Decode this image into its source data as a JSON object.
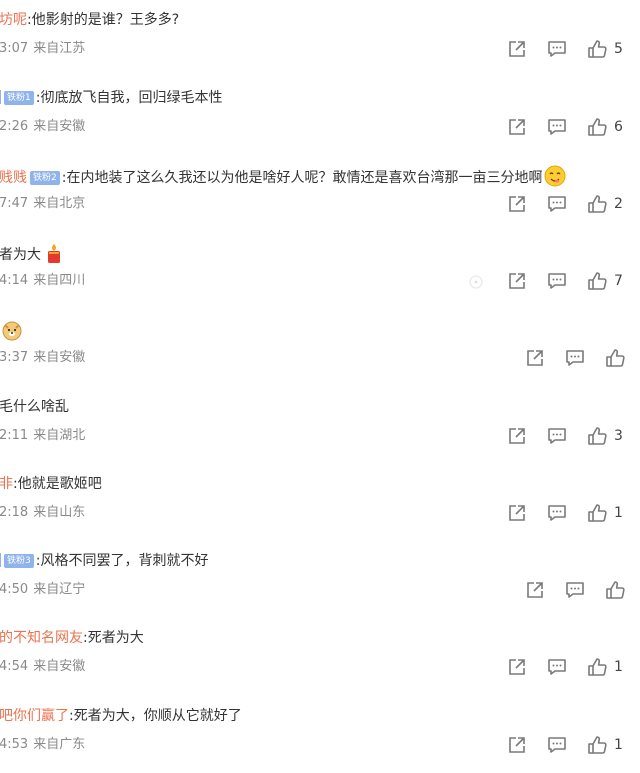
{
  "comments": [
    {
      "name": "坊呢",
      "badge": "",
      "text": ":他影射的是谁？王多多?",
      "time": "3:07",
      "location": "来自江苏",
      "likes": "5",
      "emoji": ""
    },
    {
      "name": "",
      "badge": "铁粉1",
      "text": ":彻底放飞自我，回归绿毛本性",
      "time": "2:26",
      "location": "来自安徽",
      "likes": "6",
      "emoji": ""
    },
    {
      "name": "贱贱",
      "badge": "铁粉2",
      "text": ":在内地装了这么久我还以为他是啥好人呢？敢情还是喜欢台湾那一亩三分地啊",
      "time": "7:47",
      "location": "来自北京",
      "likes": "2",
      "emoji": "yum-emoji"
    },
    {
      "name": "",
      "badge": "",
      "text": "者为大",
      "time": "4:14",
      "location": "来自四川",
      "likes": "7",
      "emoji": "candle-emoji"
    },
    {
      "name": "",
      "badge": "",
      "text": "",
      "time": "3:37",
      "location": "来自安徽",
      "likes": "",
      "emoji": "doge-emoji"
    },
    {
      "name": "",
      "badge": "",
      "text": "毛什么啥乱",
      "time": "2:11",
      "location": "来自湖北",
      "likes": "3",
      "emoji": ""
    },
    {
      "name": "非",
      "badge": "",
      "text": ":他就是歌姬吧",
      "time": "2:18",
      "location": "来自山东",
      "likes": "1",
      "emoji": ""
    },
    {
      "name": "",
      "badge": "铁粉3",
      "text": ":风格不同罢了，背刺就不好",
      "time": "4:50",
      "location": "来自辽宁",
      "likes": "",
      "emoji": ""
    },
    {
      "name": "的不知名网友",
      "badge": "",
      "text": ":死者为大",
      "time": "4:54",
      "location": "来自安徽",
      "likes": "1",
      "emoji": ""
    },
    {
      "name": "吧你们赢了",
      "badge": "",
      "text": ":死者为大，你顺从它就好了",
      "time": "4:53",
      "location": "来自广东",
      "likes": "1",
      "emoji": ""
    }
  ],
  "icons": {
    "share": "share-icon",
    "reply": "comment-icon",
    "like": "thumbs-up-icon"
  },
  "colors": {
    "username": "#eb7350",
    "badge": "#8fb3ea",
    "meta": "#8a8a8a",
    "icon": "#7a7a7a"
  }
}
